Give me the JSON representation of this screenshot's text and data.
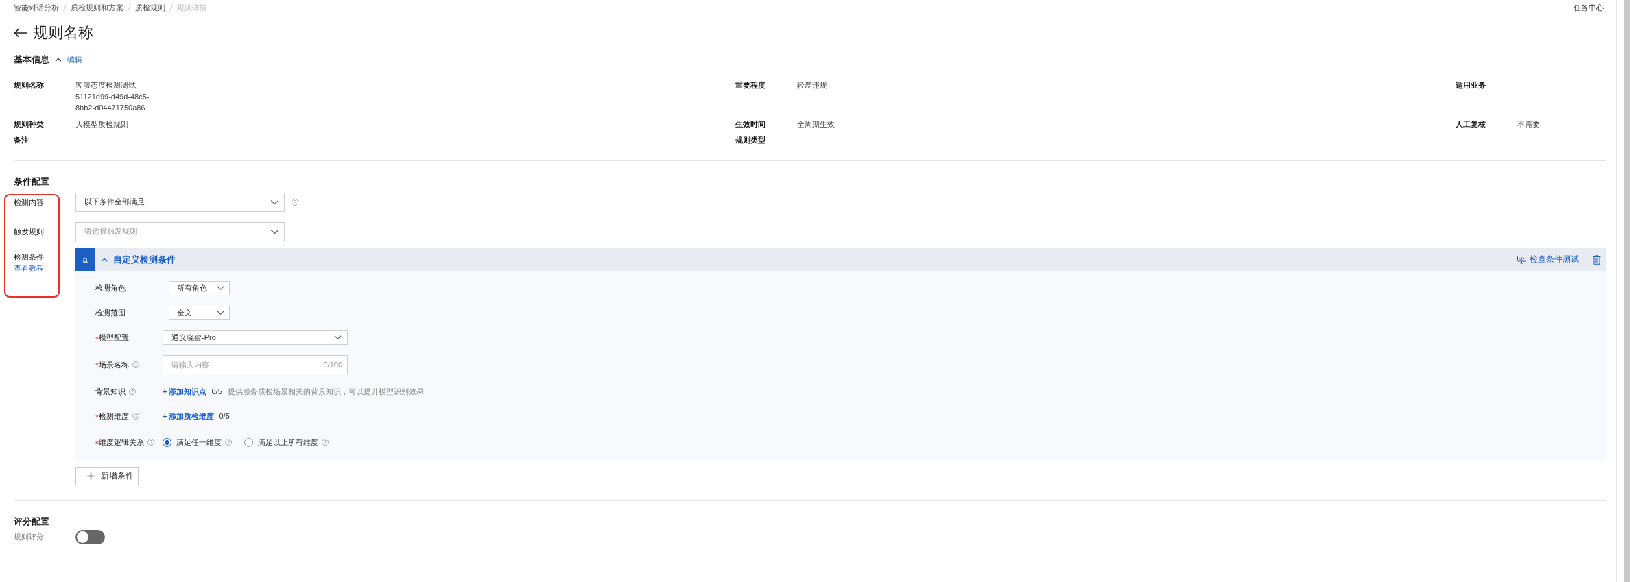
{
  "breadcrumb": [
    {
      "label": "智能对话分析",
      "current": false
    },
    {
      "label": "质检规则和方案",
      "current": false
    },
    {
      "label": "质检规则",
      "current": false
    },
    {
      "label": "规则详情",
      "current": true
    }
  ],
  "task_center": "任务中心",
  "title": "规则名称",
  "basic_info": {
    "title": "基本信息",
    "expanded": true,
    "edit": "编辑",
    "fields": [
      {
        "label": "规则名称",
        "value": "客服态度检测测试",
        "detail": "51121d99-d49d-48c5-8bb2-d04471750a86"
      },
      {
        "label": "重要程度",
        "value": "轻度违规"
      },
      {
        "label": "适用业务",
        "value": "--"
      },
      {
        "label": "规则种类",
        "value": "大模型质检规则"
      },
      {
        "label": "生效时间",
        "value": "全周期生效"
      },
      {
        "label": "人工复核",
        "value": "不需要"
      },
      {
        "label": "备注",
        "value": "--"
      },
      {
        "label": "规则类型",
        "value": "--"
      }
    ]
  },
  "condition_config": {
    "title": "条件配置",
    "labels_highlighted": true,
    "rows": [
      {
        "label": "检测内容",
        "value": "以下条件全部满足",
        "help": true
      },
      {
        "label": "触发规则",
        "placeholder": "请选择触发规则",
        "help": false
      }
    ],
    "conditions_label": "检测条件",
    "tutorial_link": "查看教程",
    "conditions": [
      {
        "badge": "a",
        "title": "自定义检测条件",
        "expanded": true,
        "test_button": "检查条件测试",
        "rows": [
          {
            "kind": "short_select",
            "label": "检测角色",
            "required": false,
            "help": false,
            "value": "所有角色"
          },
          {
            "kind": "short_select",
            "label": "检测范围",
            "required": false,
            "help": false,
            "value": "全文"
          },
          {
            "kind": "select",
            "label": "模型配置",
            "required": true,
            "help": false,
            "value": "通义晓蜜-Pro"
          },
          {
            "kind": "input",
            "label": "场景名称",
            "required": true,
            "help": true,
            "placeholder": "请输入内容",
            "counter": "0/100"
          },
          {
            "kind": "add",
            "label": "背景知识",
            "required": false,
            "help": true,
            "action": "+ 添加知识点",
            "count": "0/5",
            "hint": "提供服务质检场景相关的背景知识，可以提升模型识别效果"
          },
          {
            "kind": "add",
            "label": "检测维度",
            "required": true,
            "help": true,
            "action": "+ 添加质检维度",
            "count": "0/5"
          },
          {
            "kind": "radio",
            "label": "维度逻辑关系",
            "required": true,
            "help": true,
            "options": [
              {
                "label": "满足任一维度",
                "selected": true,
                "help": true
              },
              {
                "label": "满足以上所有维度",
                "selected": false,
                "help": true
              }
            ]
          }
        ]
      }
    ],
    "add_button": "新增条件"
  },
  "score_config": {
    "title": "评分配置",
    "label": "规则评分",
    "on": false
  }
}
